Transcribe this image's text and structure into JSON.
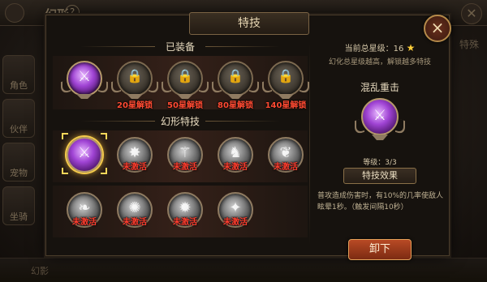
{
  "background": {
    "title": "幻形",
    "help": "?",
    "side_tabs": [
      "角色",
      "伙伴",
      "宠物",
      "坐骑"
    ],
    "right_tab": "特殊",
    "bottom_items": [
      "幻影",
      "",
      "",
      ""
    ]
  },
  "dialog": {
    "title": "特技",
    "close": "×"
  },
  "equipped": {
    "heading": "已装备",
    "slots": [
      {
        "state": "equipped",
        "icon": "purple-skill-icon"
      },
      {
        "state": "locked",
        "label": "20星解锁"
      },
      {
        "state": "locked",
        "label": "50星解锁"
      },
      {
        "state": "locked",
        "label": "80星解锁"
      },
      {
        "state": "locked",
        "label": "140星解锁"
      }
    ]
  },
  "skills": {
    "heading": "幻形特技",
    "items": [
      {
        "active": true,
        "label": ""
      },
      {
        "active": false,
        "label": "未激活"
      },
      {
        "active": false,
        "label": "未激活"
      },
      {
        "active": false,
        "label": "未激活"
      },
      {
        "active": false,
        "label": "未激活"
      },
      {
        "active": false,
        "label": "未激活"
      },
      {
        "active": false,
        "label": "未激活"
      },
      {
        "active": false,
        "label": "未激活"
      },
      {
        "active": false,
        "label": "未激活"
      }
    ]
  },
  "detail": {
    "stars_label": "当前总星级：",
    "stars_value": "16",
    "stars_hint": "幻化总星级越高，解锁越多特技",
    "skill_name": "混乱重击",
    "level_label": "等级：",
    "level_value": "3/3",
    "effect_button": "特技效果",
    "description": "普攻造成伤害时，有10%的几率使敌人眩晕1秒。（触发间隔10秒）",
    "unequip_button": "卸下"
  },
  "colors": {
    "accent_gold": "#ffcf3a",
    "status_red": "#ff3d2e",
    "button_red": "#b84a25"
  }
}
